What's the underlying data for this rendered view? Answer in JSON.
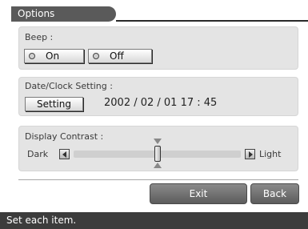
{
  "title": "Options",
  "beep": {
    "label": "Beep :",
    "on_label": "On",
    "off_label": "Off"
  },
  "date_clock": {
    "label": "Date/Clock Setting :",
    "setting_label": "Setting",
    "value": "2002 / 02 / 01   17 : 45"
  },
  "contrast": {
    "label": "Display Contrast :",
    "dark_label": "Dark",
    "light_label": "Light",
    "level": 0.5
  },
  "actions": {
    "exit_label": "Exit",
    "back_label": "Back"
  },
  "status": "Set each item.",
  "icons": {
    "left": "left-arrow-icon",
    "right": "right-arrow-icon",
    "marker_down": "triangle-down-icon",
    "marker_up": "triangle-up-icon"
  },
  "colors": {
    "panel": "#e4e4e4",
    "title_tab": "#5a5a5a",
    "action_button": "#6e6e6e",
    "status_bar": "#3c3c3c"
  }
}
